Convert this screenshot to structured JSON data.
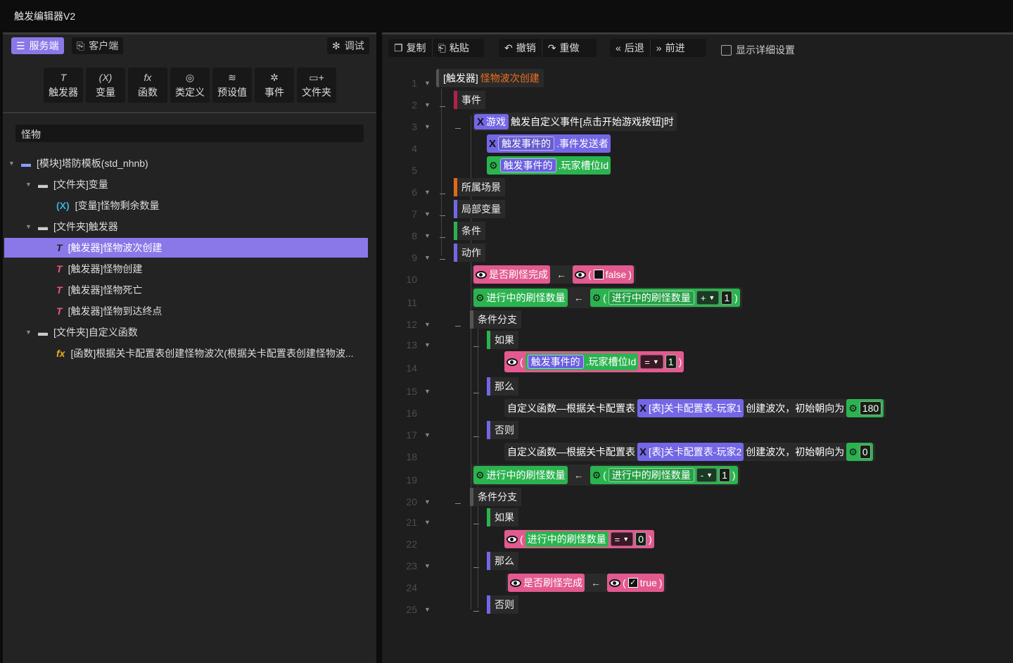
{
  "app_title": "触发编辑器V2",
  "left_panel": {
    "tabs": {
      "server": "服务端",
      "client": "客户端",
      "debug": "调试"
    },
    "tools": [
      {
        "icon": "T",
        "label": "触发器"
      },
      {
        "icon": "(X)",
        "label": "变量"
      },
      {
        "icon": "fx",
        "label": "函数"
      },
      {
        "icon": "◎",
        "label": "类定义"
      },
      {
        "icon": "≋",
        "label": "预设值"
      },
      {
        "icon": "✲",
        "label": "事件"
      },
      {
        "icon": "▭+",
        "label": "文件夹"
      }
    ],
    "search_value": "怪物",
    "tree": [
      {
        "label": "[模块]塔防模板(std_nhnb)"
      },
      {
        "label": "[文件夹]变量"
      },
      {
        "label": "[变量]怪物剩余数量"
      },
      {
        "label": "[文件夹]触发器"
      },
      {
        "label": "[触发器]怪物波次创建"
      },
      {
        "label": "[触发器]怪物创建"
      },
      {
        "label": "[触发器]怪物死亡"
      },
      {
        "label": "[触发器]怪物到达终点"
      },
      {
        "label": "[文件夹]自定义函数"
      },
      {
        "label": "[函数]根据关卡配置表创建怪物波次(根据关卡配置表创建怪物波..."
      }
    ]
  },
  "toolbar": {
    "copy": "复制",
    "paste": "粘贴",
    "undo": "撤销",
    "redo": "重做",
    "back": "后退",
    "forward": "前进",
    "show_details": "显示详细设置"
  },
  "editor": {
    "line_numbers": [
      "1",
      "2",
      "3",
      "4",
      "5",
      "6",
      "7",
      "8",
      "9",
      "10",
      "11",
      "12",
      "13",
      "14",
      "15",
      "16",
      "17",
      "18",
      "19",
      "20",
      "21",
      "22",
      "23",
      "24",
      "25"
    ],
    "trigger_prefix": "[触发器]",
    "trigger_name": "怪物波次创建",
    "event_kw": "事件",
    "game_tag": "游戏",
    "event_text": "触发自定义事件[点击开始游戏按钮]时",
    "evt_obj": "触发事件的",
    "sender": ".事件发送者",
    "player_slot": ".玩家槽位Id",
    "scene_kw": "所属场景",
    "local_kw": "局部变量",
    "cond_kw": "条件",
    "action_kw": "动作",
    "done_var": "是否刷怪完成",
    "false_val": "false",
    "true_val": "true",
    "count_var": "进行中的刷怪数量",
    "op_plus": "+",
    "op_minus": "-",
    "op_eq": "=",
    "one": "1",
    "zero": "0",
    "branch_kw": "条件分支",
    "if_kw": "如果",
    "then_kw": "那么",
    "else_kw": "否则",
    "func_text": "自定义函数—根据关卡配置表",
    "table1": "[表]关卡配置表-玩家1",
    "table2": "[表]关卡配置表-玩家2",
    "wave_text": "创建波次，初始朝向为",
    "angle180": "180",
    "angle0": "0",
    "lparen": "(",
    "rparen": ")"
  },
  "colors": {
    "accent": "#8a78e8",
    "green": "#2bb34f",
    "pink": "#e25a8f",
    "violet": "#7367e6",
    "orange": "#e06a1a"
  }
}
